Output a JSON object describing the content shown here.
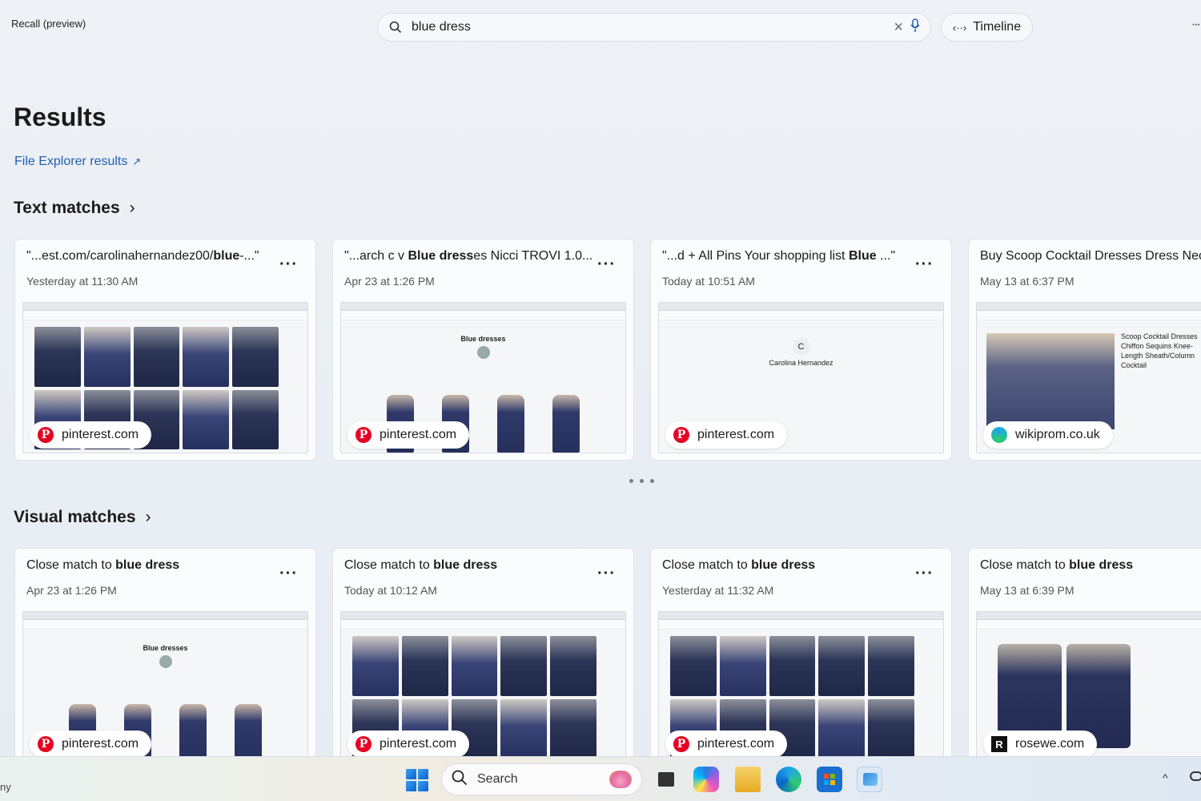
{
  "app": {
    "title": "Recall (preview)"
  },
  "search": {
    "value": "blue dress",
    "clear_label": "×"
  },
  "timeline": {
    "label": "Timeline",
    "icon": "‹··›"
  },
  "more_top": "···",
  "results": {
    "title": "Results",
    "file_explorer_link": "File Explorer results",
    "link_icon": "↗"
  },
  "text_matches": {
    "heading": "Text matches",
    "chevron": "›",
    "cards": [
      {
        "title_pre": "\"...est.com/carolinahernandez00/",
        "title_bold": "blue",
        "title_post": "-...\"",
        "date": "Yesterday at 11:30 AM",
        "source": "pinterest.com",
        "source_icon": "P",
        "more": "···"
      },
      {
        "title_pre": "\"...arch c v ",
        "title_bold": "Blue dress",
        "title_post": "es Nicci TROVI 1.0...\"",
        "date": "Apr 23 at 1:26 PM",
        "source": "pinterest.com",
        "source_icon": "P",
        "more": "···",
        "thumb_heading": "Blue dresses"
      },
      {
        "title_pre": "\"...d + All Pins Your shopping list ",
        "title_bold": "Blue",
        "title_post": " ...\"",
        "date": "Today at 10:51 AM",
        "source": "pinterest.com",
        "source_icon": "P",
        "more": "···",
        "thumb_initial": "C",
        "thumb_heading": "Carolina Hernandez"
      },
      {
        "title_pre": "Buy Scoop Cocktail Dresses Dress Neck",
        "title_bold": "",
        "title_post": "",
        "date": "May 13 at 6:37 PM",
        "source": "wikiprom.co.uk",
        "source_icon": "",
        "more": "",
        "thumb_text": "Scoop Cocktail Dresses Chiffon Sequins Knee-Length Sheath/Column Cocktail"
      }
    ]
  },
  "visual_matches": {
    "heading": "Visual matches",
    "chevron": "›",
    "cards": [
      {
        "title_pre": "Close match to ",
        "title_bold": "blue dress",
        "date": "Apr 23 at 1:26 PM",
        "source": "pinterest.com",
        "source_icon": "P",
        "more": "···",
        "thumb_heading": "Blue dresses"
      },
      {
        "title_pre": "Close match to ",
        "title_bold": "blue dress",
        "date": "Today at 10:12 AM",
        "source": "pinterest.com",
        "source_icon": "P",
        "more": "···"
      },
      {
        "title_pre": "Close match to ",
        "title_bold": "blue dress",
        "date": "Yesterday at 11:32 AM",
        "source": "pinterest.com",
        "source_icon": "P",
        "more": "···"
      },
      {
        "title_pre": "Close match to ",
        "title_bold": "blue dress",
        "date": "May 13 at 6:39 PM",
        "source": "rosewe.com",
        "source_icon": "R",
        "more": ""
      }
    ]
  },
  "taskbar": {
    "left_text": "ny",
    "search_label": "Search",
    "up_chevron": "^"
  },
  "colors": {
    "accent": "#1f5fb0",
    "pinterest": "#e60023"
  }
}
